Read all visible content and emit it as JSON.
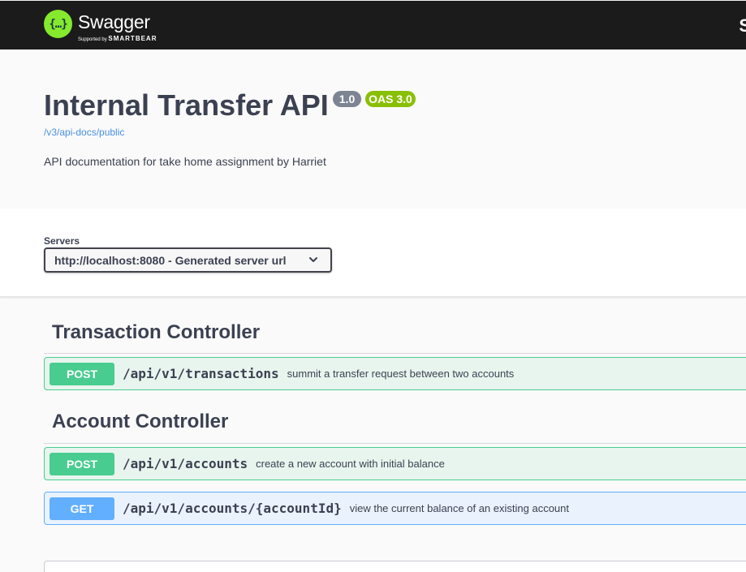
{
  "topbar": {
    "logo_symbol": "{…}",
    "logo_text": "Swagger",
    "logo_supported_by": "Supported by",
    "logo_company": "SMARTBEAR",
    "edge_text": "S"
  },
  "info": {
    "title": "Internal Transfer API",
    "version_badge": "1.0",
    "oas_badge": "OAS 3.0",
    "spec_link": "/v3/api-docs/public",
    "description": "API documentation for take home assignment by Harriet"
  },
  "servers": {
    "label": "Servers",
    "selected": "http://localhost:8080 - Generated server url",
    "icon": "chevron-down-icon"
  },
  "sections": [
    {
      "title": "Transaction Controller",
      "operations": [
        {
          "method": "POST",
          "path": "/api/v1/transactions",
          "summary": "summit a transfer request between two accounts"
        }
      ]
    },
    {
      "title": "Account Controller",
      "operations": [
        {
          "method": "POST",
          "path": "/api/v1/accounts",
          "summary": "create a new account with initial balance"
        },
        {
          "method": "GET",
          "path": "/api/v1/accounts/{accountId}",
          "summary": "view the current balance of an existing account"
        }
      ]
    }
  ],
  "colors": {
    "topbar": "#1b1b1b",
    "logo": "#85ea2d",
    "post": "#49cc90",
    "get": "#61affe",
    "version_badge": "#7d8492",
    "oas_badge": "#89bf04",
    "link": "#4990e2"
  }
}
